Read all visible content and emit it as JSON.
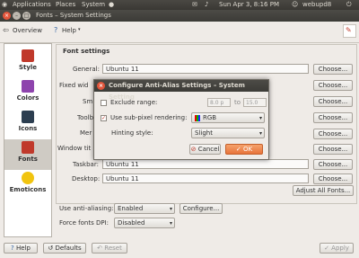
{
  "panel": {
    "apps": "Applications",
    "places": "Places",
    "system": "System",
    "datetime": "Sun Apr 3, 8:16 PM",
    "user": "webupd8"
  },
  "window": {
    "title": "Fonts – System Settings"
  },
  "toolbar": {
    "overview": "Overview",
    "help": "Help"
  },
  "sidebar": {
    "items": [
      {
        "label": "Style",
        "color": "#c0392b"
      },
      {
        "label": "Colors",
        "color": "#8e44ad"
      },
      {
        "label": "Icons",
        "color": "#2c3e50"
      },
      {
        "label": "Fonts",
        "color": "#c0392b"
      },
      {
        "label": "Emoticons",
        "color": "#f1c40f"
      }
    ]
  },
  "fonts": {
    "header": "Font settings",
    "rows": [
      {
        "label": "General:",
        "value": "Ubuntu 11",
        "button": "Choose..."
      },
      {
        "label": "Fixed wid",
        "value": "",
        "button": "Choose..."
      },
      {
        "label": "Sm",
        "value": "",
        "button": "Choose..."
      },
      {
        "label": "Toolb",
        "value": "",
        "button": "Choose..."
      },
      {
        "label": "Mer",
        "value": "",
        "button": "Choose..."
      },
      {
        "label": "Window tit",
        "value": "",
        "button": "Choose..."
      },
      {
        "label": "Taskbar:",
        "value": "Ubuntu 11",
        "button": "Choose..."
      },
      {
        "label": "Desktop:",
        "value": "Ubuntu 11",
        "button": "Choose..."
      }
    ],
    "adjust_all": "Adjust All Fonts...",
    "anti_alias_label": "Use anti-aliasing:",
    "anti_alias_value": "Enabled",
    "configure": "Configure...",
    "force_dpi_label": "Force fonts DPI:",
    "force_dpi_value": "Disabled"
  },
  "dialog": {
    "title": "Configure Anti-Alias Settings – System Setting",
    "exclude_label": "Exclude range:",
    "exclude_from": "8.0 p",
    "exclude_to_label": "to",
    "exclude_to": "15.0",
    "subpixel_label": "Use sub-pixel rendering:",
    "subpixel_value": "RGB",
    "hinting_label": "Hinting style:",
    "hinting_value": "Slight",
    "cancel": "Cancel",
    "ok": "OK"
  },
  "bottom": {
    "help": "Help",
    "defaults": "Defaults",
    "reset": "Reset",
    "apply": "Apply"
  }
}
